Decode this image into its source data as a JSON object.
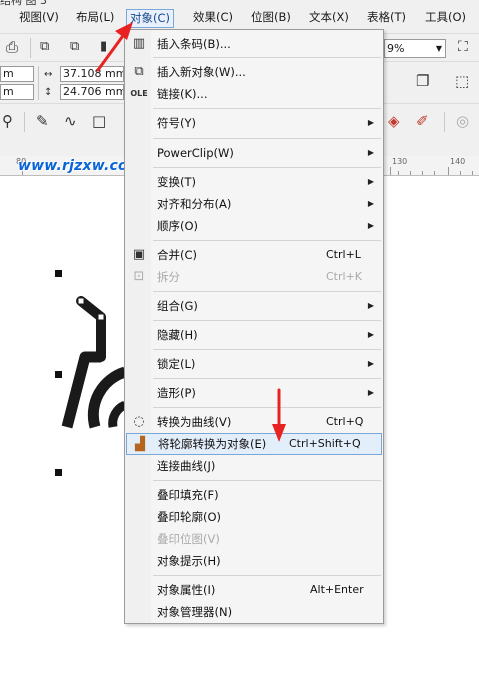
{
  "menubar": {
    "clipped_top": "结构 图 3",
    "items": [
      "视图(V)",
      "布局(L)",
      "对象(C)",
      "效果(C)",
      "位图(B)",
      "文本(X)",
      "表格(T)",
      "工具(O)"
    ]
  },
  "toolbar": {
    "w_value": "m",
    "h_value": "m",
    "x_value": "37.108 mm",
    "y_value": "24.706 mm",
    "zoom_value": "9%",
    "colors": {
      "accent": "#7aa7d6",
      "arrow_red": "#e82222",
      "watermark": "#0a64d8"
    }
  },
  "ruler": {
    "labels": [
      "80",
      "130",
      "140"
    ]
  },
  "watermark": "www.rjzxw.com",
  "menu": {
    "items": [
      {
        "icon": "barcode-icon",
        "label": "插入条码(B)...",
        "shortcut": "",
        "submenu": false,
        "disabled": false
      },
      {
        "icon": "insert-object-icon",
        "label": "插入新对象(W)...",
        "shortcut": "",
        "submenu": false,
        "disabled": false
      },
      {
        "icon": "ole-icon",
        "label": "链接(K)...",
        "shortcut": "",
        "submenu": false,
        "disabled": false
      },
      {
        "icon": "",
        "label": "符号(Y)",
        "shortcut": "",
        "submenu": true,
        "disabled": false
      },
      {
        "icon": "",
        "label": "PowerClip(W)",
        "shortcut": "",
        "submenu": true,
        "disabled": false
      },
      {
        "icon": "",
        "label": "变换(T)",
        "shortcut": "",
        "submenu": true,
        "disabled": false
      },
      {
        "icon": "",
        "label": "对齐和分布(A)",
        "shortcut": "",
        "submenu": true,
        "disabled": false
      },
      {
        "icon": "",
        "label": "顺序(O)",
        "shortcut": "",
        "submenu": true,
        "disabled": false
      },
      {
        "icon": "combine-icon",
        "label": "合并(C)",
        "shortcut": "Ctrl+L",
        "submenu": false,
        "disabled": false
      },
      {
        "icon": "break-apart-icon",
        "label": "拆分",
        "shortcut": "Ctrl+K",
        "submenu": false,
        "disabled": true
      },
      {
        "icon": "",
        "label": "组合(G)",
        "shortcut": "",
        "submenu": true,
        "disabled": false
      },
      {
        "icon": "",
        "label": "隐藏(H)",
        "shortcut": "",
        "submenu": true,
        "disabled": false
      },
      {
        "icon": "",
        "label": "锁定(L)",
        "shortcut": "",
        "submenu": true,
        "disabled": false
      },
      {
        "icon": "",
        "label": "造形(P)",
        "shortcut": "",
        "submenu": true,
        "disabled": false
      },
      {
        "icon": "convert-curves-icon",
        "label": "转换为曲线(V)",
        "shortcut": "Ctrl+Q",
        "submenu": false,
        "disabled": false
      },
      {
        "icon": "outline-to-object-icon",
        "label": "将轮廓转换为对象(E)",
        "shortcut": "Ctrl+Shift+Q",
        "submenu": false,
        "disabled": false,
        "highlighted": true
      },
      {
        "icon": "",
        "label": "连接曲线(J)",
        "shortcut": "",
        "submenu": false,
        "disabled": false
      },
      {
        "icon": "",
        "label": "叠印填充(F)",
        "shortcut": "",
        "submenu": false,
        "disabled": false
      },
      {
        "icon": "",
        "label": "叠印轮廓(O)",
        "shortcut": "",
        "submenu": false,
        "disabled": false
      },
      {
        "icon": "",
        "label": "叠印位图(V)",
        "shortcut": "",
        "submenu": false,
        "disabled": true
      },
      {
        "icon": "",
        "label": "对象提示(H)",
        "shortcut": "",
        "submenu": false,
        "disabled": false
      },
      {
        "icon": "",
        "label": "对象属性(I)",
        "shortcut": "Alt+Enter",
        "submenu": false,
        "disabled": false
      },
      {
        "icon": "",
        "label": "对象管理器(N)",
        "shortcut": "",
        "submenu": false,
        "disabled": false
      }
    ]
  }
}
